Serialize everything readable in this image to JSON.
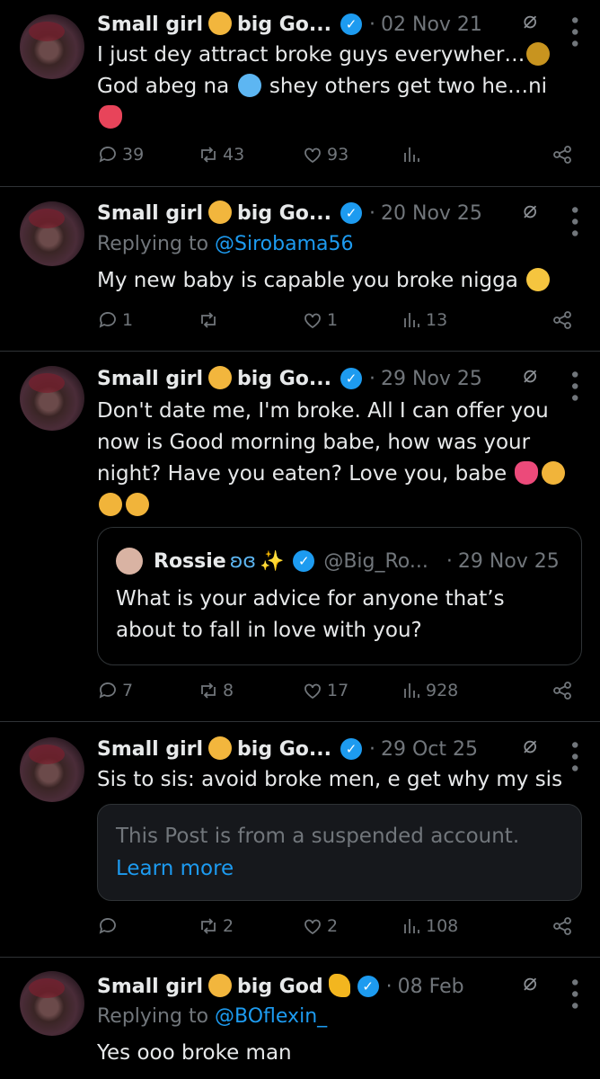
{
  "tweets": [
    {
      "name": "Small girl",
      "name_suffix": "big Go...",
      "date": "02 Nov 21",
      "lines": [
        "I just dey attract broke guys everywher…",
        "God abeg na",
        "shey others get two he…ni"
      ],
      "counts": {
        "reply": "39",
        "repost": "43",
        "like": "93",
        "views": ""
      }
    },
    {
      "name": "Small girl",
      "name_suffix": "big Go...",
      "date": "20 Nov 25",
      "replying_label": "Replying to",
      "replying_handle": "@Sirobama56",
      "lines": [
        "My new baby is capable you broke nigga"
      ],
      "counts": {
        "reply": "1",
        "repost": "",
        "like": "1",
        "views": "13"
      }
    },
    {
      "name": "Small girl",
      "name_suffix": "big Go...",
      "date": "29 Nov 25",
      "lines": [
        "Don't date me, I'm broke. All I can offer you",
        "now is Good morning babe, how was your",
        "night? Have you eaten? Love you, babe"
      ],
      "quote": {
        "name": "Rossie",
        "handle": "@Big_Ro...",
        "date": "29 Nov 25",
        "lines": [
          "What is your advice for anyone that’s",
          "about to fall in love with you?"
        ]
      },
      "counts": {
        "reply": "7",
        "repost": "8",
        "like": "17",
        "views": "928"
      }
    },
    {
      "name": "Small girl",
      "name_suffix": "big Go...",
      "date": "29 Oct 25",
      "lines": [
        "Sis to sis: avoid broke men, e get why my sis"
      ],
      "suspended": {
        "text": "This Post is from a suspended account.",
        "link": "Learn more"
      },
      "counts": {
        "reply": "",
        "repost": "2",
        "like": "2",
        "views": "108"
      }
    },
    {
      "name": "Small girl",
      "name_suffix": "big God",
      "date": "08 Feb",
      "replying_label": "Replying to",
      "replying_handle": "@BOflexin_",
      "lines": [
        "Yes ooo broke man"
      ]
    }
  ],
  "icons": [
    "reply-icon",
    "repost-icon",
    "like-icon",
    "views-icon",
    "share-icon",
    "grok-icon",
    "more-icon",
    "verified-badge-icon"
  ],
  "colors": {
    "background": "#000000",
    "accent": "#1d9bf0",
    "muted": "#71767b",
    "text": "#e7e9ea",
    "divider": "#2f3336"
  }
}
